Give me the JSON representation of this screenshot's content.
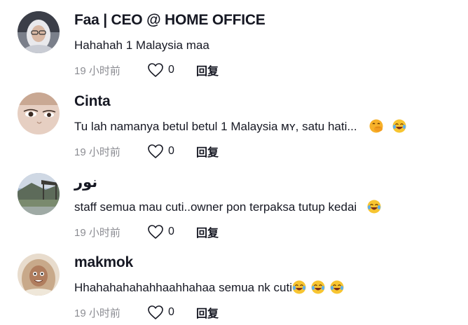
{
  "comments": [
    {
      "username": "Faa | CEO @ HOME OFFICE",
      "text": "Hahahah 1 Malaysia maa",
      "emojis": [],
      "time": "19 小时前",
      "likes": "0",
      "reply_label": "回复"
    },
    {
      "username": "Cinta",
      "text": "Tu lah namanya betul betul 1 Malaysia ᴍʏ, satu hati...",
      "emojis": [
        "face-with-hand-over-mouth",
        "face-with-tears-of-joy"
      ],
      "time": "19 小时前",
      "likes": "0",
      "reply_label": "回复"
    },
    {
      "username": "نور",
      "text": "staff semua mau cuti..owner pon terpaksa tutup kedai",
      "emojis": [
        "face-with-tears-of-joy"
      ],
      "time": "19 小时前",
      "likes": "0",
      "reply_label": "回复"
    },
    {
      "username": "makmok",
      "text": "Hhahahahahahhaahhahaa semua nk cuti",
      "emojis": [
        "face-with-tears-of-joy",
        "face-with-tears-of-joy",
        "face-with-tears-of-joy"
      ],
      "time": "19 小时前",
      "likes": "0",
      "reply_label": "回复"
    }
  ]
}
